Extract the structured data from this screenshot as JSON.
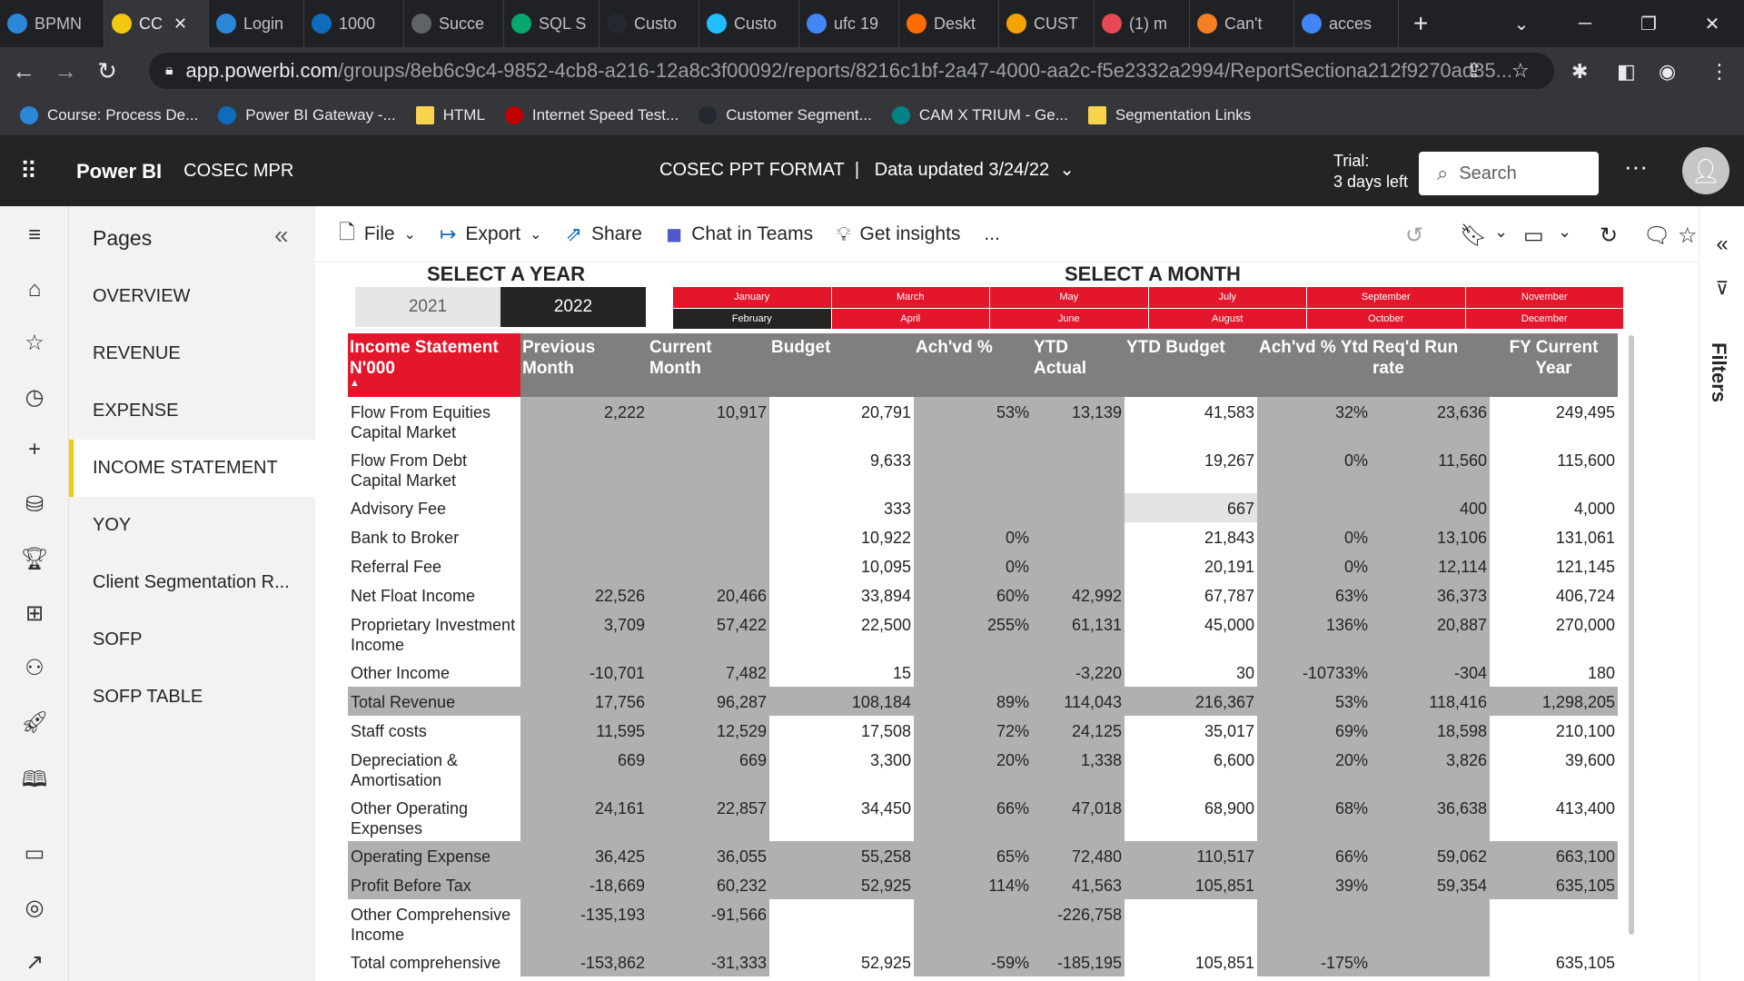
{
  "browser": {
    "tabs": [
      {
        "label": "BPMN",
        "icon": "powerapps-icon",
        "color": "#2b88d8"
      },
      {
        "label": "CC",
        "icon": "powerbi-icon",
        "color": "#f2c811",
        "active": true
      },
      {
        "label": "Login",
        "icon": "powerapps-icon",
        "color": "#2b88d8"
      },
      {
        "label": "1000",
        "icon": "onedrive-icon",
        "color": "#0f6cbd"
      },
      {
        "label": "Succe",
        "icon": "globe-icon",
        "color": "#5f6368"
      },
      {
        "label": "SQL S",
        "icon": "w3schools-icon",
        "color": "#04aa6d"
      },
      {
        "label": "Custo",
        "icon": "github-icon",
        "color": "#24292f"
      },
      {
        "label": "Custo",
        "icon": "kaggle-icon",
        "color": "#20beff"
      },
      {
        "label": "ufc 19",
        "icon": "google-icon",
        "color": "#4285f4"
      },
      {
        "label": "Deskt",
        "icon": "desktop-app-icon",
        "color": "#ff6d00"
      },
      {
        "label": "CUST",
        "icon": "document-icon",
        "color": "#f4a300"
      },
      {
        "label": "(1) m",
        "icon": "m365-icon",
        "color": "#e74856"
      },
      {
        "label": "Can't",
        "icon": "stackoverflow-icon",
        "color": "#f48024"
      },
      {
        "label": "acces",
        "icon": "google-icon",
        "color": "#4285f4"
      }
    ],
    "new_tab": "+",
    "url_domain": "app.powerbi.com",
    "url_path": "/groups/8eb6c9c4-9852-4cb8-a216-12a8c3f00092/reports/8216c1bf-2a47-4000-aa2c-f5e2332a2994/ReportSectiona212f9270ad35...",
    "bookmarks": [
      {
        "label": "Course: Process De...",
        "icon": "powerapps-icon",
        "color": "#2b88d8"
      },
      {
        "label": "Power BI Gateway -...",
        "icon": "gateway-icon",
        "color": "#0f6cbd"
      },
      {
        "label": "HTML",
        "icon": "folder-icon",
        "color": "#f9d34c"
      },
      {
        "label": "Internet Speed Test...",
        "icon": "speedtest-icon",
        "color": "#c00000"
      },
      {
        "label": "Customer Segment...",
        "icon": "github-icon",
        "color": "#24292f"
      },
      {
        "label": "CAM X TRIUM - Ge...",
        "icon": "sharepoint-icon",
        "color": "#038387"
      },
      {
        "label": "Segmentation Links",
        "icon": "folder-icon",
        "color": "#f9d34c"
      }
    ]
  },
  "header": {
    "brand": "Power BI",
    "workspace": "COSEC MPR",
    "report_name": "COSEC PPT FORMAT",
    "data_updated": "Data updated 3/24/22",
    "trial_line1": "Trial:",
    "trial_line2": "3 days left",
    "search_placeholder": "Search"
  },
  "pages": {
    "title": "Pages",
    "items": [
      {
        "label": "OVERVIEW"
      },
      {
        "label": "REVENUE"
      },
      {
        "label": "EXPENSE"
      },
      {
        "label": "INCOME STATEMENT",
        "selected": true
      },
      {
        "label": "YOY"
      },
      {
        "label": "Client Segmentation R..."
      },
      {
        "label": "SOFP"
      },
      {
        "label": "SOFP TABLE"
      }
    ]
  },
  "toolbar": {
    "file": "File",
    "export": "Export",
    "share": "Share",
    "chat": "Chat in Teams",
    "insights": "Get insights",
    "more": "..."
  },
  "filters": {
    "label": "Filters"
  },
  "report": {
    "year_heading": "SELECT A YEAR",
    "month_heading": "SELECT A MONTH",
    "years": [
      {
        "label": "2021",
        "selected": false
      },
      {
        "label": "2022",
        "selected": true
      }
    ],
    "months_row1": [
      "January",
      "March",
      "May",
      "July",
      "September",
      "November"
    ],
    "months_row2": [
      "February",
      "April",
      "June",
      "August",
      "October",
      "December"
    ],
    "selected_month": "February",
    "columns": [
      "Income Statement N'000",
      "Previous Month",
      "Current Month",
      "Budget",
      "Ach'vd %",
      "YTD Actual",
      "YTD Budget",
      "Ach'vd % Ytd",
      "Req'd Run rate",
      "FY Current Year"
    ],
    "rows": [
      {
        "label": "Flow From Equities Capital Market",
        "values": [
          "2,222",
          "10,917",
          "20,791",
          "53%",
          "13,139",
          "41,583",
          "32%",
          "23,636",
          "249,495"
        ]
      },
      {
        "label": "Flow From Debt Capital Market",
        "values": [
          "",
          "",
          "9,633",
          "",
          "",
          "19,267",
          "0%",
          "11,560",
          "115,600"
        ]
      },
      {
        "label": "Advisory Fee",
        "values": [
          "",
          "",
          "333",
          "",
          "",
          "667",
          "",
          "400",
          "4,000"
        ]
      },
      {
        "label": "Bank to Broker",
        "values": [
          "",
          "",
          "10,922",
          "0%",
          "",
          "21,843",
          "0%",
          "13,106",
          "131,061"
        ]
      },
      {
        "label": "Referral Fee",
        "values": [
          "",
          "",
          "10,095",
          "0%",
          "",
          "20,191",
          "0%",
          "12,114",
          "121,145"
        ]
      },
      {
        "label": "Net Float Income",
        "values": [
          "22,526",
          "20,466",
          "33,894",
          "60%",
          "42,992",
          "67,787",
          "63%",
          "36,373",
          "406,724"
        ]
      },
      {
        "label": "Proprietary Investment Income",
        "values": [
          "3,709",
          "57,422",
          "22,500",
          "255%",
          "61,131",
          "45,000",
          "136%",
          "20,887",
          "270,000"
        ]
      },
      {
        "label": "Other Income",
        "values": [
          "-10,701",
          "7,482",
          "15",
          "",
          "-3,220",
          "30",
          "-10733%",
          "-304",
          "180"
        ]
      },
      {
        "label": "Total Revenue",
        "total": true,
        "values": [
          "17,756",
          "96,287",
          "108,184",
          "89%",
          "114,043",
          "216,367",
          "53%",
          "118,416",
          "1,298,205"
        ]
      },
      {
        "label": "Staff costs",
        "values": [
          "11,595",
          "12,529",
          "17,508",
          "72%",
          "24,125",
          "35,017",
          "69%",
          "18,598",
          "210,100"
        ]
      },
      {
        "label": "Depreciation & Amortisation",
        "values": [
          "669",
          "669",
          "3,300",
          "20%",
          "1,338",
          "6,600",
          "20%",
          "3,826",
          "39,600"
        ]
      },
      {
        "label": "Other Operating Expenses",
        "values": [
          "24,161",
          "22,857",
          "34,450",
          "66%",
          "47,018",
          "68,900",
          "68%",
          "36,638",
          "413,400"
        ]
      },
      {
        "label": "Operating Expense",
        "total": true,
        "values": [
          "36,425",
          "36,055",
          "55,258",
          "65%",
          "72,480",
          "110,517",
          "66%",
          "59,062",
          "663,100"
        ]
      },
      {
        "label": "Profit Before Tax",
        "total": true,
        "values": [
          "-18,669",
          "60,232",
          "52,925",
          "114%",
          "41,563",
          "105,851",
          "39%",
          "59,354",
          "635,105"
        ]
      },
      {
        "label": "Other Comprehensive Income",
        "values": [
          "-135,193",
          "-91,566",
          "",
          "",
          "-226,758",
          "",
          "",
          "",
          ""
        ]
      },
      {
        "label": "Total comprehensive",
        "values": [
          "-153,862",
          "-31,333",
          "52,925",
          "-59%",
          "-185,195",
          "105,851",
          "-175%",
          "",
          "635,105"
        ]
      }
    ]
  },
  "colors": {
    "accent_red": "#e3162b",
    "header_dark": "#252423",
    "column_gray": "#7f7f7f",
    "cell_gray": "#b0b0b0",
    "selected_page": "#f2c811"
  }
}
